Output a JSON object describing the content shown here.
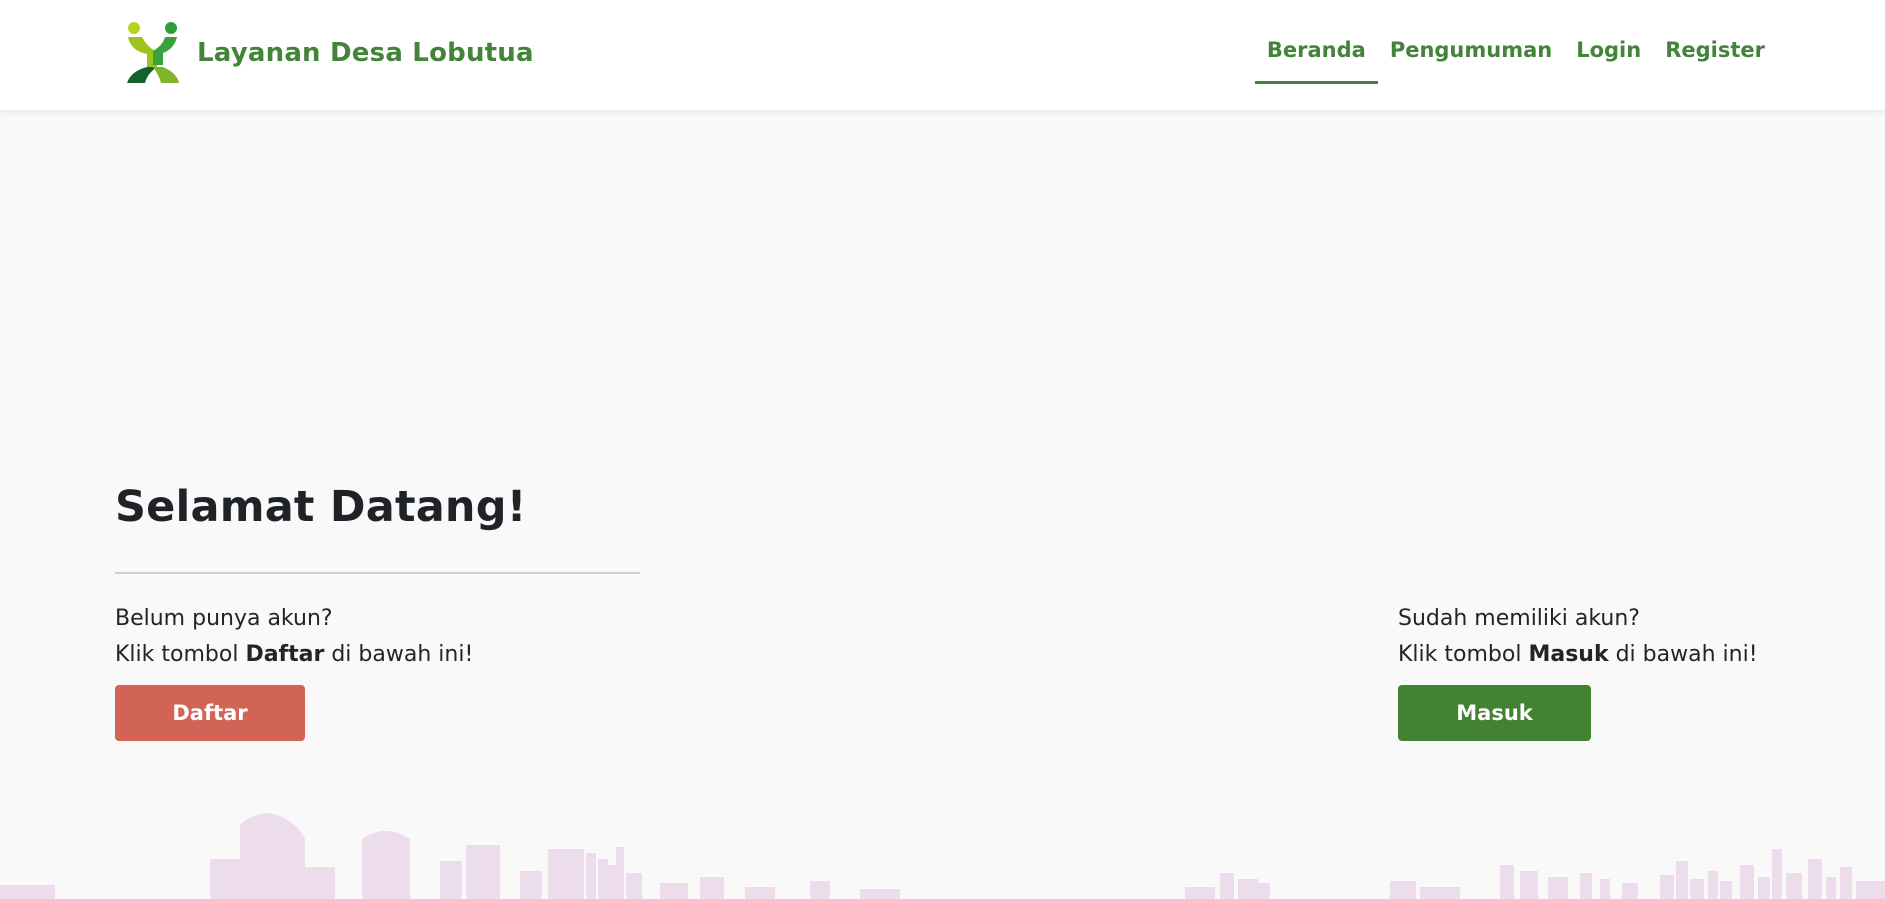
{
  "header": {
    "brand_name": "Layanan Desa Lobutua",
    "nav": [
      {
        "label": "Beranda",
        "active": true
      },
      {
        "label": "Pengumuman",
        "active": false
      },
      {
        "label": "Login",
        "active": false
      },
      {
        "label": "Register",
        "active": false
      }
    ]
  },
  "hero": {
    "title": "Selamat Datang!",
    "register": {
      "question": "Belum punya akun?",
      "instruction_prefix": "Klik tombol",
      "instruction_bold": "Daftar",
      "instruction_suffix": "di bawah ini!",
      "button_label": "Daftar"
    },
    "login": {
      "question": "Sudah memiliki akun?",
      "instruction_prefix": "Klik tombol",
      "instruction_bold": "Masuk",
      "instruction_suffix": "di bawah ini!",
      "button_label": "Masuk"
    }
  },
  "colors": {
    "brand_green": "#43833a",
    "register_button": "#d26457",
    "login_button": "#438232",
    "skyline": "#ecdcec"
  },
  "icons": {
    "brand_logo": "people-logo-icon",
    "background": "city-skyline-illustration"
  }
}
